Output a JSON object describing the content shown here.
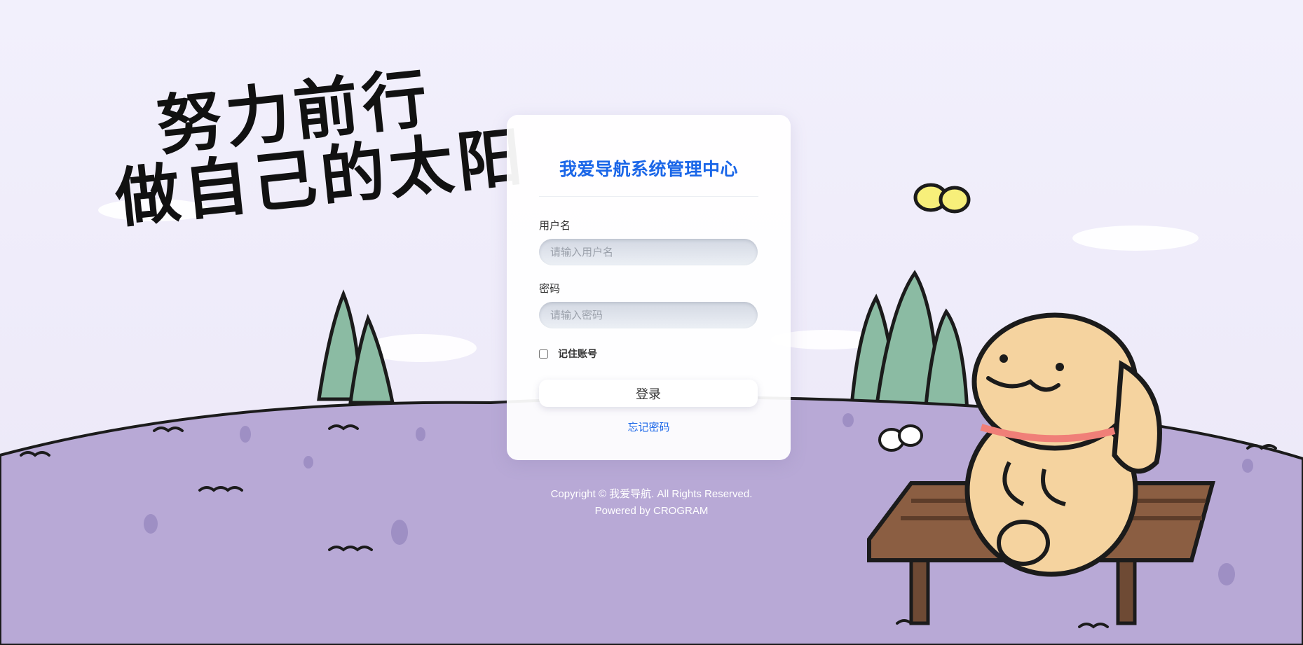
{
  "background": {
    "slogan_line1": "努力前行",
    "slogan_line2": "做自己的太阳",
    "sky_color": "#f1effb",
    "hill_color": "#b8a9d6"
  },
  "login": {
    "title": "我爱导航系统管理中心",
    "username_label": "用户名",
    "username_placeholder": "请输入用户名",
    "username_value": "",
    "password_label": "密码",
    "password_placeholder": "请输入密码",
    "password_value": "",
    "remember_label": "记住账号",
    "remember_checked": false,
    "login_button": "登录",
    "forgot_link": "忘记密码",
    "accent_color": "#1a66e8"
  },
  "footer": {
    "copyright": "Copyright © 我爱导航. All Rights Reserved.",
    "powered_by": "Powered by CROGRAM"
  }
}
